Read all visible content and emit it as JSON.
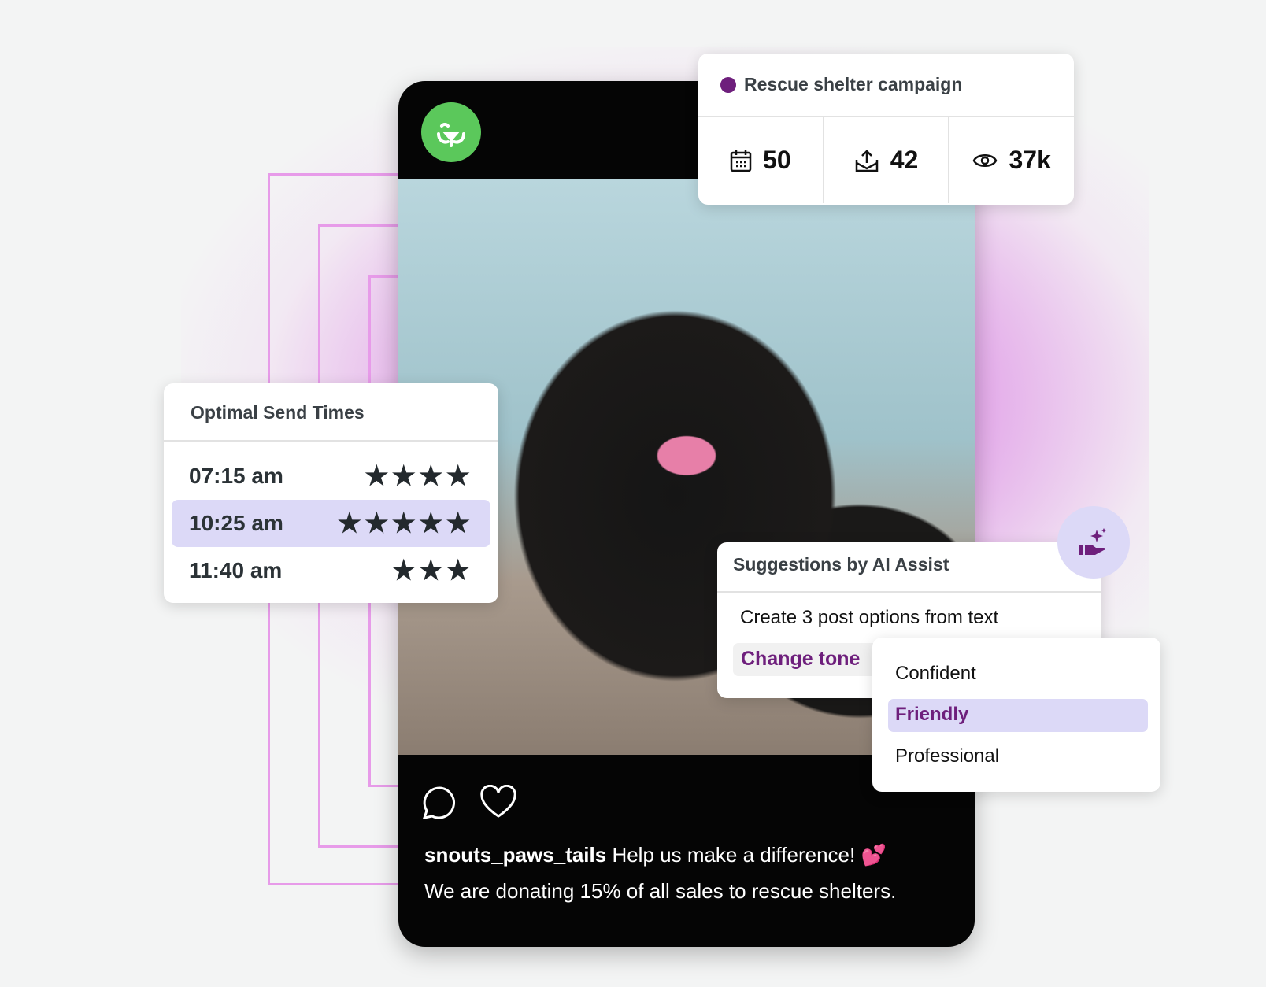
{
  "colors": {
    "accent": "#6e1f7c",
    "highlight": "#dcd9f7",
    "logo": "#5bc85b"
  },
  "campaign": {
    "title": "Rescue shelter campaign",
    "stats": [
      {
        "icon": "calendar-icon",
        "value": "50"
      },
      {
        "icon": "share-icon",
        "value": "42"
      },
      {
        "icon": "eye-icon",
        "value": "37k"
      }
    ]
  },
  "send_times": {
    "title": "Optimal Send Times",
    "rows": [
      {
        "time": "07:15 am",
        "stars": 4,
        "selected": false
      },
      {
        "time": "10:25 am",
        "stars": 5,
        "selected": true
      },
      {
        "time": "11:40 am",
        "stars": 3,
        "selected": false
      }
    ]
  },
  "ai_assist": {
    "title": "Suggestions by AI Assist",
    "items": [
      "Create 3 post options from text",
      "Change tone"
    ],
    "tone_options": [
      "Confident",
      "Friendly",
      "Professional"
    ],
    "selected_tone": "Friendly"
  },
  "post": {
    "username": "snouts_paws_tails",
    "line1": "Help us make a difference! 💕",
    "line2": "We are donating 15% of all sales to rescue shelters."
  }
}
